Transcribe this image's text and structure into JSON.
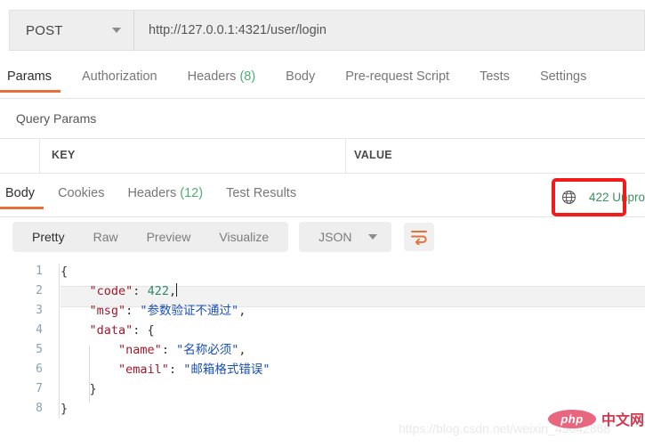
{
  "request": {
    "method": "POST",
    "url": "http://127.0.0.1:4321/user/login",
    "tabs": [
      {
        "label": "Params",
        "count": "",
        "active": true
      },
      {
        "label": "Authorization",
        "count": "",
        "active": false
      },
      {
        "label": "Headers",
        "count": "(8)",
        "active": false
      },
      {
        "label": "Body",
        "count": "",
        "active": false
      },
      {
        "label": "Pre-request Script",
        "count": "",
        "active": false
      },
      {
        "label": "Tests",
        "count": "",
        "active": false
      },
      {
        "label": "Settings",
        "count": "",
        "active": false
      }
    ],
    "query_params_label": "Query Params",
    "table_headers": {
      "key": "KEY",
      "value": "VALUE"
    }
  },
  "response": {
    "tabs": [
      {
        "label": "Body",
        "count": "",
        "active": true
      },
      {
        "label": "Cookies",
        "count": "",
        "active": false
      },
      {
        "label": "Headers",
        "count": "(12)",
        "active": false
      },
      {
        "label": "Test Results",
        "count": "",
        "active": false
      }
    ],
    "status": "422 Unpro",
    "status_icon": "globe-icon",
    "format_tabs": [
      {
        "label": "Pretty",
        "active": true
      },
      {
        "label": "Raw",
        "active": false
      },
      {
        "label": "Preview",
        "active": false
      },
      {
        "label": "Visualize",
        "active": false
      }
    ],
    "language": "JSON",
    "wrap_icon": "word-wrap-icon",
    "code_lines": [
      {
        "no": "1",
        "segments": [
          {
            "t": "{",
            "c": "k-punct"
          }
        ]
      },
      {
        "no": "2",
        "segments": [
          {
            "t": "    ",
            "c": "k-punct"
          },
          {
            "t": "\"code\"",
            "c": "k-key"
          },
          {
            "t": ": ",
            "c": "k-punct"
          },
          {
            "t": "422",
            "c": "k-num"
          },
          {
            "t": ",",
            "c": "k-punct"
          }
        ],
        "caret": true,
        "active": true
      },
      {
        "no": "3",
        "segments": [
          {
            "t": "    ",
            "c": "k-punct"
          },
          {
            "t": "\"msg\"",
            "c": "k-key"
          },
          {
            "t": ": ",
            "c": "k-punct"
          },
          {
            "t": "\"参数验证不通过\"",
            "c": "k-str"
          },
          {
            "t": ",",
            "c": "k-punct"
          }
        ]
      },
      {
        "no": "4",
        "segments": [
          {
            "t": "    ",
            "c": "k-punct"
          },
          {
            "t": "\"data\"",
            "c": "k-key"
          },
          {
            "t": ": {",
            "c": "k-punct"
          }
        ]
      },
      {
        "no": "5",
        "segments": [
          {
            "t": "        ",
            "c": "k-punct"
          },
          {
            "t": "\"name\"",
            "c": "k-key"
          },
          {
            "t": ": ",
            "c": "k-punct"
          },
          {
            "t": "\"名称必须\"",
            "c": "k-str"
          },
          {
            "t": ",",
            "c": "k-punct"
          }
        ]
      },
      {
        "no": "6",
        "segments": [
          {
            "t": "        ",
            "c": "k-punct"
          },
          {
            "t": "\"email\"",
            "c": "k-key"
          },
          {
            "t": ": ",
            "c": "k-punct"
          },
          {
            "t": "\"邮箱格式错误\"",
            "c": "k-str"
          }
        ]
      },
      {
        "no": "7",
        "segments": [
          {
            "t": "    }",
            "c": "k-punct"
          }
        ]
      },
      {
        "no": "8",
        "segments": [
          {
            "t": "}",
            "c": "k-punct"
          }
        ]
      }
    ]
  },
  "watermarks": {
    "csdn_url": "https://blog.csdn.net/weixin_45042868",
    "php_logo_text": "php",
    "php_logo_cn": "中文网"
  },
  "colors": {
    "accent": "#e8703a",
    "status_green": "#3d9160",
    "annotation_red": "#f21b1b"
  }
}
